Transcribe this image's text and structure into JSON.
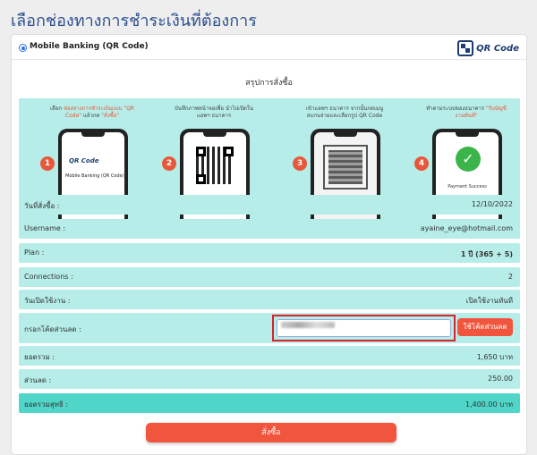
{
  "page": {
    "title": "เลือกช่องทางการชำระเงินที่ต้องการ"
  },
  "payment_method": {
    "label": "Mobile Banking (QR Code)",
    "logo_text": "QR Code",
    "selected": true
  },
  "summary": {
    "title": "สรุปการสั่งซื้อ"
  },
  "steps": [
    {
      "number": "1",
      "text_pre": "เลือก ",
      "text_hl": "ช่องทางการชำระเงินแบบ \"QR Code\"",
      "text_mid": " แล้วกด ",
      "text_hl2": "\"สั่งซื้อ\"",
      "screen_logo": "QR Code",
      "screen_option": "Mobile Banking (QR Code)"
    },
    {
      "number": "2",
      "text": "บันทึกภาพหน้าจอเพื่อ นำไปเปิดในแอพฯ ธนาคาร"
    },
    {
      "number": "3",
      "text": "เข้าแอพฯ ธนาคาร จากนั้นกดเมนู สแกนจ่ายและเลือกรูป QR Code"
    },
    {
      "number": "4",
      "text_pre": "ทำตามระบบของธนาคาร ",
      "text_hl": "\"รับบัญชีงานทันที\"",
      "screen_caption": "Payment Success"
    }
  ],
  "order": {
    "date_label": "วันที่สั่งซื้อ :",
    "date_value": "12/10/2022",
    "username_label": "Username :",
    "username_value": "ayaine_eye@hotmail.com",
    "plan_label": "Plan :",
    "plan_value": "1 ปี (365 + 5)",
    "connections_label": "Connections :",
    "connections_value": "2",
    "start_label": "วันเปิดใช้งาน :",
    "start_value": "เปิดใช้งานทันที",
    "discount_label": "กรอกโค้ดส่วนลด :",
    "discount_input_value": "",
    "discount_button": "ใช้โค้ดส่วนลด",
    "subtotal_label": "ยอดรวม :",
    "subtotal_value": "1,650 บาท",
    "discount_amount_label": "ส่วนลด :",
    "discount_amount_value": "250.00",
    "total_label": "ยอดรวมสุทธิ :",
    "total_value": "1,400.00 บาท"
  },
  "order_button": "สั่งซื้อ",
  "colors": {
    "accent": "#f2553d",
    "row_bg": "#b6ede8",
    "total_bg": "#4fd6c8",
    "title": "#2d4f8e"
  }
}
